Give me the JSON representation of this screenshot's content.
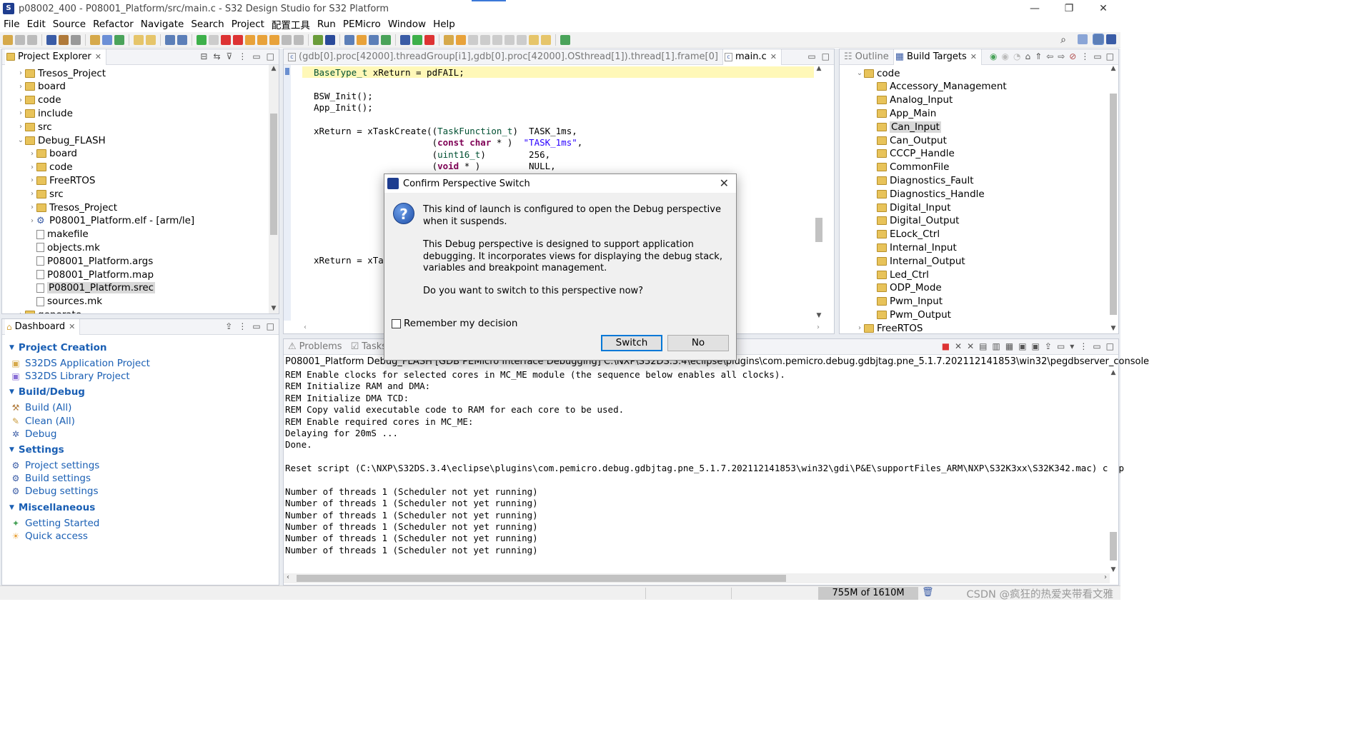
{
  "window": {
    "title": "p08002_400 - P08001_Platform/src/main.c - S32 Design Studio for S32 Platform",
    "minimize": "—",
    "maximize": "❐",
    "close": "✕"
  },
  "menu": [
    "File",
    "Edit",
    "Source",
    "Refactor",
    "Navigate",
    "Search",
    "Project",
    "配置工具",
    "Run",
    "PEMicro",
    "Window",
    "Help"
  ],
  "project_explorer": {
    "tab": "Project Explorer",
    "items": [
      {
        "label": "Tresos_Project",
        "type": "proj"
      },
      {
        "label": "board",
        "type": "proj"
      },
      {
        "label": "code",
        "type": "proj"
      },
      {
        "label": "include",
        "type": "proj"
      },
      {
        "label": "src",
        "type": "proj"
      },
      {
        "label": "Debug_FLASH",
        "type": "folder"
      },
      {
        "label": "board",
        "type": "folder"
      },
      {
        "label": "code",
        "type": "folder"
      },
      {
        "label": "FreeRTOS",
        "type": "folder"
      },
      {
        "label": "src",
        "type": "folder"
      },
      {
        "label": "Tresos_Project",
        "type": "folder"
      },
      {
        "label": "P08001_Platform.elf - [arm/le]",
        "type": "elf"
      },
      {
        "label": "makefile",
        "type": "file"
      },
      {
        "label": "objects.mk",
        "type": "file"
      },
      {
        "label": "P08001_Platform.args",
        "type": "file"
      },
      {
        "label": "P08001_Platform.map",
        "type": "file"
      },
      {
        "label": "P08001_Platform.srec",
        "type": "file"
      },
      {
        "label": "sources.mk",
        "type": "file"
      },
      {
        "label": "generate",
        "type": "folder"
      }
    ]
  },
  "editor": {
    "tab_inactive": "(gdb[0].proc[42000].threadGroup[i1],gdb[0].proc[42000].OSthread[1]).thread[1].frame[0]",
    "tab_active": "main.c"
  },
  "outline": {
    "tab_outline": "Outline",
    "tab_build": "Build Targets",
    "root": "code",
    "items": [
      "Accessory_Management",
      "Analog_Input",
      "App_Main",
      "Can_Input",
      "Can_Output",
      "CCCP_Handle",
      "CommonFile",
      "Diagnostics_Fault",
      "Diagnostics_Handle",
      "Digital_Input",
      "Digital_Output",
      "ELock_Ctrl",
      "Internal_Input",
      "Internal_Output",
      "Led_Ctrl",
      "ODP_Mode",
      "Pwm_Input",
      "Pwm_Output"
    ],
    "selected": "Can_Input",
    "last": "FreeRTOS"
  },
  "dashboard": {
    "tab": "Dashboard",
    "sections": [
      {
        "title": "Project Creation",
        "items": [
          "S32DS Application Project",
          "S32DS Library Project"
        ]
      },
      {
        "title": "Build/Debug",
        "items": [
          "Build  (All)",
          "Clean  (All)",
          "Debug"
        ]
      },
      {
        "title": "Settings",
        "items": [
          "Project settings",
          "Build settings",
          "Debug settings"
        ]
      },
      {
        "title": "Miscellaneous",
        "items": [
          "Getting Started",
          "Quick access"
        ]
      }
    ]
  },
  "console": {
    "tab_problems": "Problems",
    "tab_tasks": "Tasks",
    "header": "P08001_Platform Debug_FLASH [GDB PEMicro Interface Debugging] C:\\NXP\\S32DS.3.4\\eclipse\\plugins\\com.pemicro.debug.gdbjtag.pne_5.1.7.202112141853\\win32\\pegdbserver_console",
    "lines": [
      "REM Enable clocks for selected cores in MC_ME module (the sequence below enables all clocks).",
      "REM Initialize RAM and DMA:",
      "REM Initialize DMA TCD:",
      "REM Copy valid executable code to RAM for each core to be used.",
      "REM Enable required cores in MC_ME:",
      "Delaying for 20mS ...",
      "Done.",
      "",
      "Reset script (C:\\NXP\\S32DS.3.4\\eclipse\\plugins\\com.pemicro.debug.gdbjtag.pne_5.1.7.202112141853\\win32\\gdi\\P&E\\supportFiles_ARM\\NXP\\S32K3xx\\S32K342.mac) comp",
      "",
      "Number of threads 1 (Scheduler not yet running)",
      "Number of threads 1 (Scheduler not yet running)",
      "Number of threads 1 (Scheduler not yet running)",
      "Number of threads 1 (Scheduler not yet running)",
      "Number of threads 1 (Scheduler not yet running)",
      "Number of threads 1 (Scheduler not yet running)"
    ]
  },
  "dialog": {
    "title": "Confirm Perspective Switch",
    "p1": "This kind of launch is configured to open the Debug perspective when it suspends.",
    "p2": "This Debug perspective is designed to support application debugging. It incorporates views for displaying the debug stack, variables and breakpoint management.",
    "p3": "Do you want to switch to this perspective now?",
    "remember": "Remember my decision",
    "switch": "Switch",
    "no": "No"
  },
  "status": {
    "memory": "755M of 1610M",
    "watermark": "CSDN @疯狂的热爱夹带看文雅"
  },
  "colors": {
    "link": "#1a5fb4",
    "keyword": "#7f0055",
    "string": "#2a00ff"
  }
}
